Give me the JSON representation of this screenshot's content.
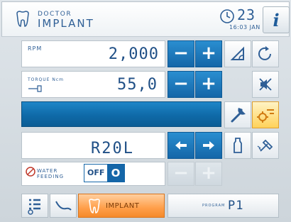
{
  "header": {
    "line1": "DOCTOR",
    "line2": "IMPLANT",
    "date_day": "23",
    "time_date": "16:03 JAN",
    "info_label": "i"
  },
  "rpm": {
    "label": "RPM",
    "value": "2,000"
  },
  "torque": {
    "label": "TORQUE Ncm",
    "value": "55,0"
  },
  "tool": {
    "name": "R20L"
  },
  "water": {
    "label_line1": "WATER",
    "label_line2": "FEEDING",
    "toggle_text": "OFF",
    "toggle_knob": "O"
  },
  "buttons": {
    "minus": "−",
    "plus": "+"
  },
  "bottom": {
    "mode_label": "IMPLANT",
    "program_label": "PROGRAM",
    "program_value": "P1"
  },
  "colors": {
    "accent_blue": "#1466a8",
    "active_orange": "#ff9f4a",
    "text_blue": "#2f5f96"
  },
  "icons": [
    "tooth-icon",
    "clock-icon",
    "angle-icon",
    "rotate-icon",
    "wrench-icon",
    "gear-settings-icon",
    "mute-icon",
    "bottle-icon",
    "brush-icon",
    "list-icon",
    "curve-icon",
    "arrow-left-icon",
    "arrow-right-icon",
    "no-water-icon"
  ]
}
